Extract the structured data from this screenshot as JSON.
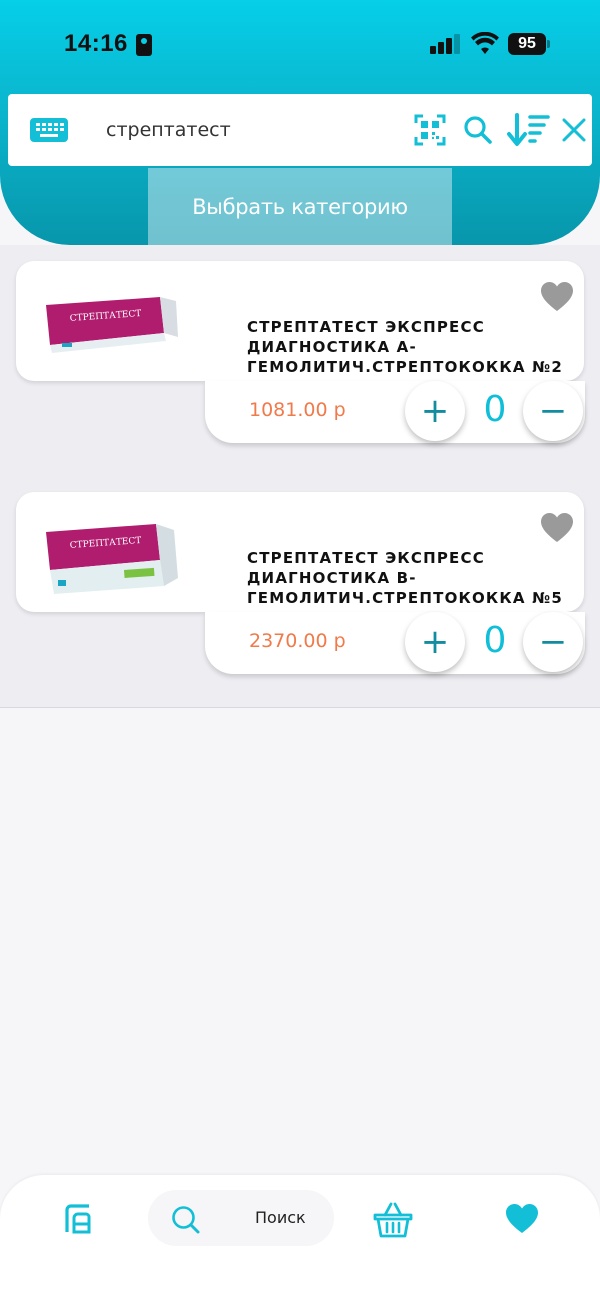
{
  "status_bar": {
    "time": "14:16",
    "battery": "95"
  },
  "search": {
    "value": "стрептатест"
  },
  "category_button": {
    "label": "Выбрать категорию"
  },
  "icons": {
    "keyboard": "keyboard-icon",
    "qr": "qr-code-icon",
    "search": "search-icon",
    "sort": "sort-icon",
    "clear": "close-icon",
    "favorite": "heart-icon"
  },
  "products": [
    {
      "name": "СТРЕПТАТЕСТ ЭКСПРЕСС ДИАГНОСТИКА А-ГЕМОЛИТИЧ.СТРЕПТОКОККА №2",
      "price": "1081.00 р",
      "quantity": "0",
      "plus": "+",
      "minus": "−"
    },
    {
      "name": "СТРЕПТАТЕСТ ЭКСПРЕСС ДИАГНОСТИКА В-ГЕМОЛИТИЧ.СТРЕПТОКОККА №5",
      "price": "2370.00 р",
      "quantity": "0",
      "plus": "+",
      "minus": "−"
    }
  ],
  "bottom_nav": {
    "search_label": "Поиск"
  },
  "colors": {
    "accent": "#0fbfd8",
    "price": "#f07a4a",
    "heart": "#9a9a9a"
  }
}
